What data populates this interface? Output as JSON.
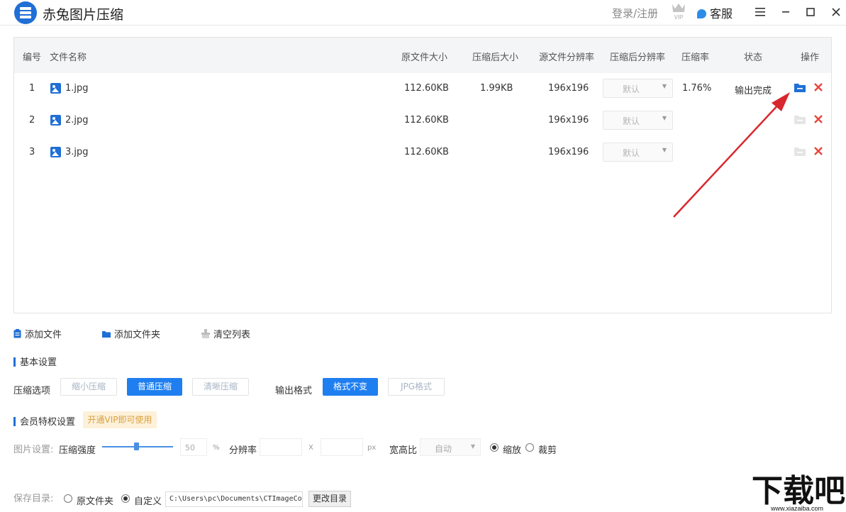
{
  "app": {
    "title": "赤兔图片压缩",
    "login_label": "登录/注册",
    "service_label": "客服"
  },
  "table": {
    "headers": [
      "编号",
      "文件名称",
      "原文件大小",
      "压缩后大小",
      "源文件分辨率",
      "压缩后分辨率",
      "压缩率",
      "状态",
      "操作"
    ],
    "rows": [
      {
        "index": "1",
        "name": "1.jpg",
        "original_size": "112.60KB",
        "compressed_size": "1.99KB",
        "source_resolution": "196x196",
        "target_resolution": "默认",
        "ratio": "1.76%",
        "status": "输出完成"
      },
      {
        "index": "2",
        "name": "2.jpg",
        "original_size": "112.60KB",
        "compressed_size": "",
        "source_resolution": "196x196",
        "target_resolution": "默认",
        "ratio": "",
        "status": ""
      },
      {
        "index": "3",
        "name": "3.jpg",
        "original_size": "112.60KB",
        "compressed_size": "",
        "source_resolution": "196x196",
        "target_resolution": "默认",
        "ratio": "",
        "status": ""
      }
    ]
  },
  "toolbar": {
    "add_file": "添加文件",
    "add_folder": "添加文件夹",
    "clear_list": "清空列表"
  },
  "basic": {
    "title": "基本设置",
    "compress_label": "压缩选项",
    "compress_options": [
      "缩小压缩",
      "普通压缩",
      "清晰压缩"
    ],
    "compress_selected": "普通压缩",
    "format_label": "输出格式",
    "format_options": [
      "格式不变",
      "JPG格式"
    ],
    "format_selected": "格式不变"
  },
  "member": {
    "title": "会员特权设置",
    "vip_tag": "开通VIP即可使用",
    "image_settings_label": "图片设置:",
    "strength_label": "压缩强度",
    "strength_value": "50",
    "strength_unit": "%",
    "resolution_label": "分辨率",
    "resolution_sep": "X",
    "resolution_unit": "px",
    "aspect_label": "宽高比",
    "aspect_value": "自动",
    "scale_label": "缩放",
    "crop_label": "裁剪",
    "scale_selected": true
  },
  "save": {
    "label": "保存目录:",
    "original_folder": "原文件夹",
    "custom": "自定义",
    "custom_selected": true,
    "path": "C:\\Users\\pc\\Documents\\CTImageCo",
    "change_dir": "更改目录"
  },
  "colors": {
    "accent": "#1f7ff0",
    "delete": "#e8453c",
    "arrow": "#d9272e"
  }
}
